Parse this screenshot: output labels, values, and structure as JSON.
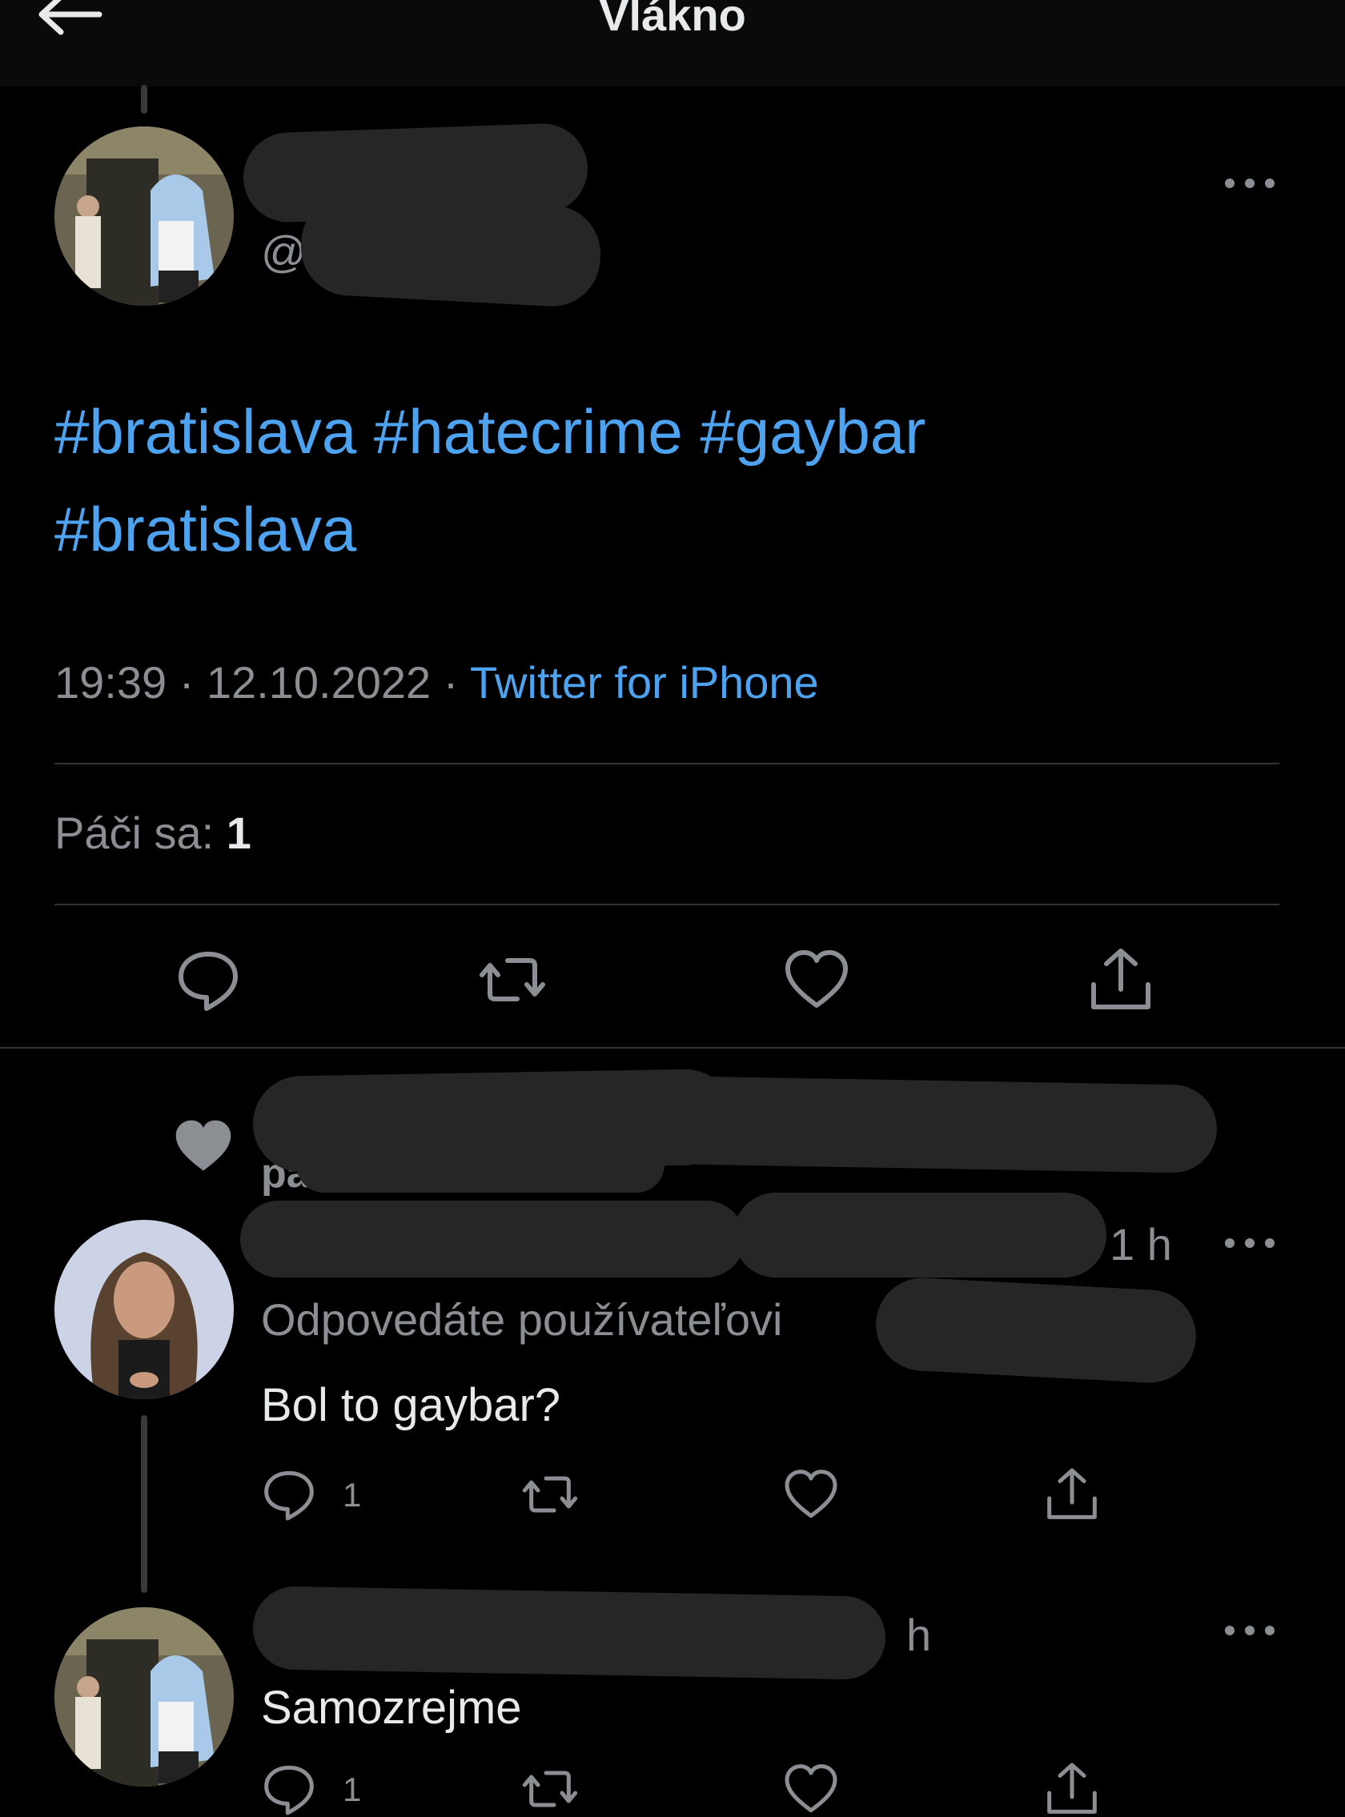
{
  "header": {
    "title": "Vlákno"
  },
  "icons": {
    "back": "arrow-left-icon",
    "more": "ellipsis-icon",
    "reply": "speech-bubble-icon",
    "retweet": "retweet-icon",
    "like": "heart-icon",
    "share": "share-upload-icon"
  },
  "main_tweet": {
    "handle_prefix": "@",
    "hashtags_line1": "#bratislava #hatecrime #gaybar",
    "hashtags_line2": "#bratislava",
    "time_date": "19:39 · 12.10.2022 · ",
    "source": "Twitter for iPhone",
    "likes_label": "Páči sa: ",
    "likes_count": "1"
  },
  "liked_notice": {
    "text_fragment": "pa"
  },
  "reply_1": {
    "time": "1 h",
    "replying_to": "Odpovedáte používateľovi",
    "text": "Bol to gaybar?",
    "reply_count": "1"
  },
  "reply_2": {
    "time": "h",
    "text": "Samozrejme",
    "reply_count": "1"
  },
  "colors": {
    "background": "#000000",
    "link": "#4da3ef",
    "muted": "#8b8f94",
    "text": "#e7e9ea",
    "divider": "#2f3336"
  }
}
